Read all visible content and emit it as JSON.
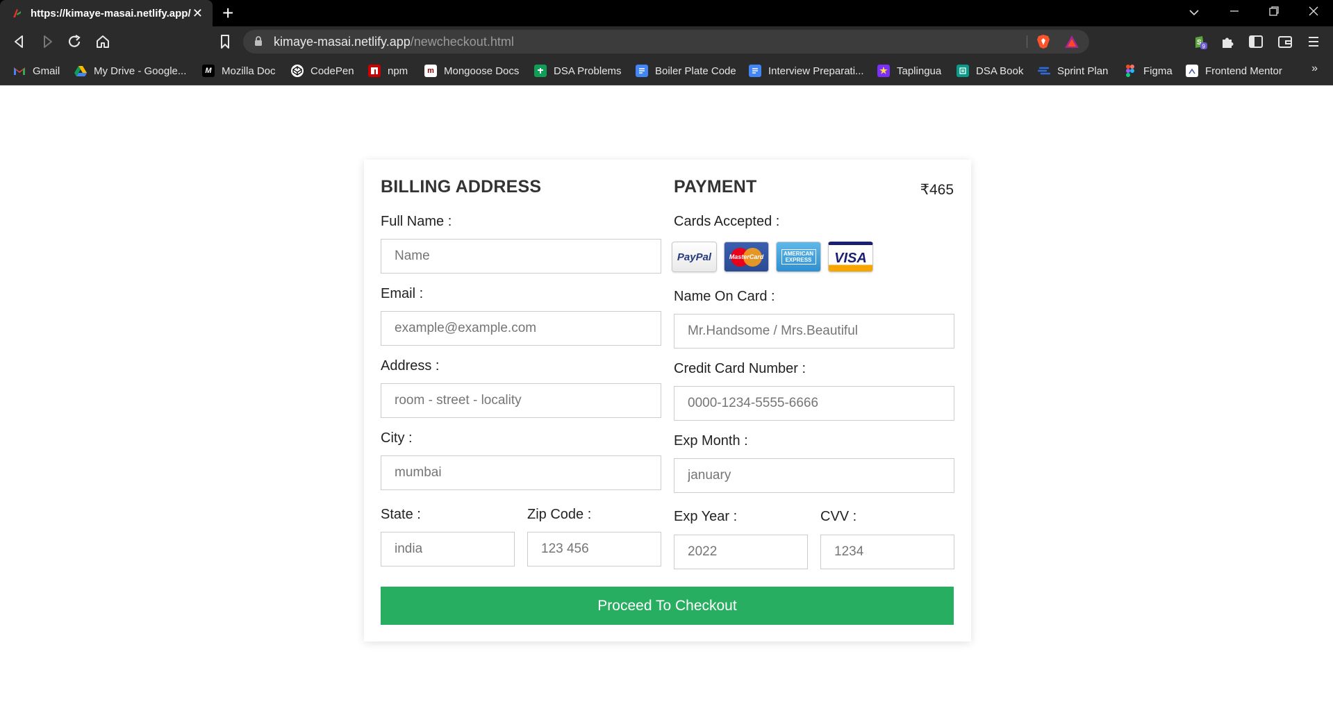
{
  "browser": {
    "tab_title": "https://kimaye-masai.netlify.app/",
    "url_host": "kimaye-masai.netlify.app",
    "url_path": "/newcheckout.html",
    "extensions_badge": "9",
    "bookmarks": [
      {
        "label": "Gmail",
        "icon": "gmail-icon",
        "color": "#ea4335"
      },
      {
        "label": "My Drive - Google...",
        "icon": "google-drive-icon",
        "color": "#1fa463"
      },
      {
        "label": "Mozilla Doc",
        "icon": "mdn-icon",
        "color": "#000000"
      },
      {
        "label": "CodePen",
        "icon": "codepen-icon",
        "color": "#ffffff"
      },
      {
        "label": "npm",
        "icon": "npm-icon",
        "color": "#cb0000"
      },
      {
        "label": "Mongoose Docs",
        "icon": "mongoose-icon",
        "color": "#880000"
      },
      {
        "label": "DSA Problems",
        "icon": "sheets-icon",
        "color": "#0f9d58"
      },
      {
        "label": "Boiler Plate Code",
        "icon": "docs-icon",
        "color": "#4285f4"
      },
      {
        "label": "Interview Preparati...",
        "icon": "docs-icon",
        "color": "#4285f4"
      },
      {
        "label": "Taplingua",
        "icon": "star-icon",
        "color": "#7b2ff7"
      },
      {
        "label": "DSA Book",
        "icon": "book-icon",
        "color": "#0b9b8a"
      },
      {
        "label": "Sprint Plan",
        "icon": "sprint-icon",
        "color": "#2d6cdf"
      },
      {
        "label": "Figma",
        "icon": "figma-icon",
        "color": "#f24e1e"
      },
      {
        "label": "Frontend Mentor",
        "icon": "frontend-mentor-icon",
        "color": "#ffffff"
      }
    ],
    "more_bookmarks": "»"
  },
  "checkout": {
    "billing": {
      "title": "BILLING ADDRESS",
      "full_name_label": "Full Name :",
      "full_name_placeholder": "Name",
      "email_label": "Email :",
      "email_placeholder": "example@example.com",
      "address_label": "Address :",
      "address_placeholder": "room - street - locality",
      "city_label": "City :",
      "city_placeholder": "mumbai",
      "state_label": "State :",
      "state_placeholder": "india",
      "zip_label": "Zip Code :",
      "zip_placeholder": "123 456"
    },
    "payment": {
      "title": "PAYMENT",
      "price": "₹465",
      "cards_label": "Cards Accepted :",
      "cards": [
        {
          "name": "PayPal",
          "icon": "paypal-icon"
        },
        {
          "name": "MasterCard",
          "icon": "mastercard-icon"
        },
        {
          "name": "AMERICAN EXPRESS",
          "icon": "amex-icon"
        },
        {
          "name": "VISA",
          "icon": "visa-icon"
        }
      ],
      "name_on_card_label": "Name On Card :",
      "name_on_card_placeholder": "Mr.Handsome / Mrs.Beautiful",
      "card_number_label": "Credit Card Number :",
      "card_number_placeholder": "0000-1234-5555-6666",
      "exp_month_label": "Exp Month :",
      "exp_month_placeholder": "january",
      "exp_year_label": "Exp Year :",
      "exp_year_placeholder": "2022",
      "cvv_label": "CVV :",
      "cvv_placeholder": "1234"
    },
    "submit_label": "Proceed To Checkout",
    "colors": {
      "button": "#27ae60",
      "heading": "#333333"
    }
  }
}
